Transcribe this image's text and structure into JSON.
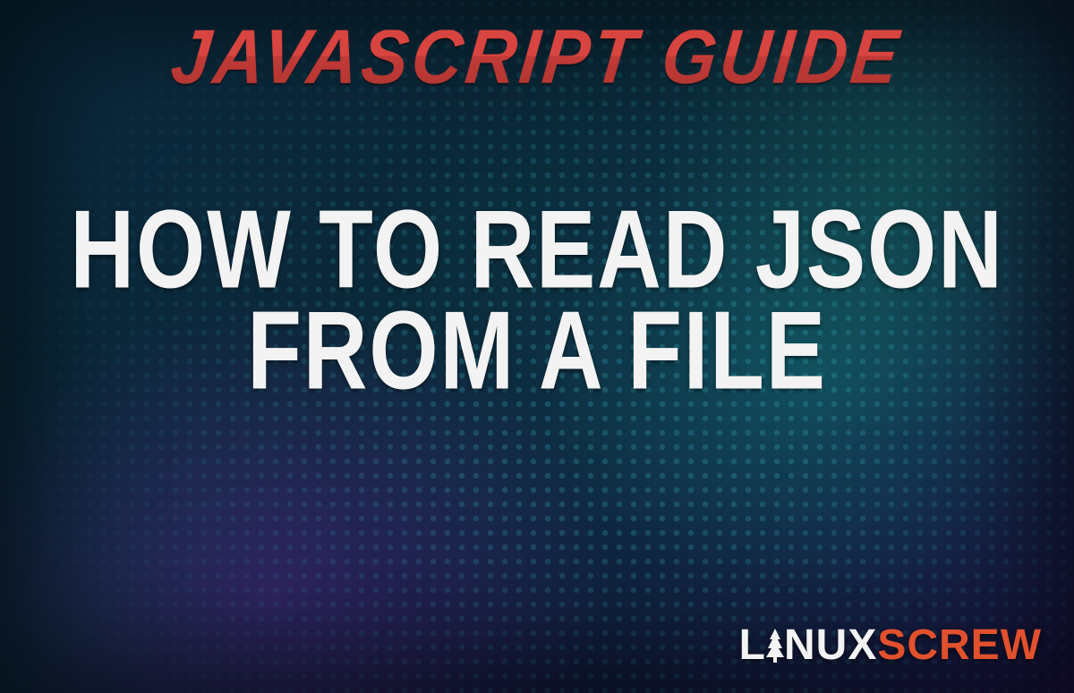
{
  "header": {
    "subtitle": "JAVASCRIPT GUIDE"
  },
  "main": {
    "title_line1": "HOW TO READ JSON",
    "title_line2": "FROM A FILE"
  },
  "branding": {
    "logo_part1": "L",
    "logo_part2": "NUX",
    "logo_part3": "SCREW",
    "icon": "tree-icon"
  }
}
